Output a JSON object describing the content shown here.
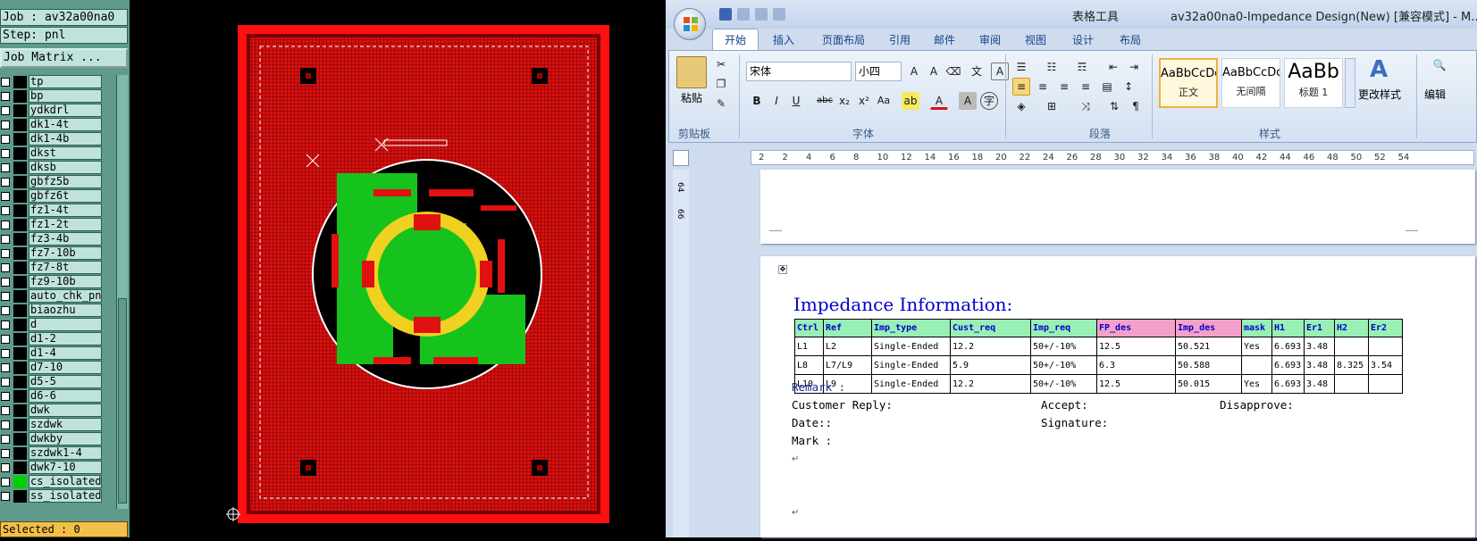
{
  "cam": {
    "job_label": "Job : av32a00na0",
    "step_label": "Step: pnl",
    "job_matrix_button": "Job Matrix ...",
    "selected_status": "Selected : 0",
    "layers": [
      {
        "name": "tp",
        "color": "#000000"
      },
      {
        "name": "bp",
        "color": "#000000"
      },
      {
        "name": "ydkdrl",
        "color": "#000000"
      },
      {
        "name": "dk1-4t",
        "color": "#000000"
      },
      {
        "name": "dk1-4b",
        "color": "#000000"
      },
      {
        "name": "dkst",
        "color": "#000000"
      },
      {
        "name": "dksb",
        "color": "#000000"
      },
      {
        "name": "gbfz5b",
        "color": "#000000"
      },
      {
        "name": "gbfz6t",
        "color": "#000000"
      },
      {
        "name": "fz1-4t",
        "color": "#000000"
      },
      {
        "name": "fz1-2t",
        "color": "#000000"
      },
      {
        "name": "fz3-4b",
        "color": "#000000"
      },
      {
        "name": "fz7-10b",
        "color": "#000000"
      },
      {
        "name": "fz7-8t",
        "color": "#000000"
      },
      {
        "name": "fz9-10b",
        "color": "#000000"
      },
      {
        "name": "auto_chk_pnl",
        "color": "#000000"
      },
      {
        "name": "biaozhu",
        "color": "#000000"
      },
      {
        "name": "d",
        "color": "#000000"
      },
      {
        "name": "d1-2",
        "color": "#000000"
      },
      {
        "name": "d1-4",
        "color": "#000000"
      },
      {
        "name": "d7-10",
        "color": "#000000"
      },
      {
        "name": "d5-5",
        "color": "#000000"
      },
      {
        "name": "d6-6",
        "color": "#000000"
      },
      {
        "name": "dwk",
        "color": "#000000"
      },
      {
        "name": "szdwk",
        "color": "#000000"
      },
      {
        "name": "dwkby",
        "color": "#000000"
      },
      {
        "name": "szdwk1-4",
        "color": "#000000"
      },
      {
        "name": "dwk7-10",
        "color": "#000000"
      },
      {
        "name": "cs_isolated",
        "color": "#00d000"
      },
      {
        "name": "ss_isolated",
        "color": "#000000"
      }
    ]
  },
  "word": {
    "context_tab_title": "表格工具",
    "document_title": "av32a00na0-Impedance Design(New) [兼容模式] - M...",
    "tabs": [
      "开始",
      "插入",
      "页面布局",
      "引用",
      "邮件",
      "审阅",
      "视图",
      "设计",
      "布局"
    ],
    "ribbon": {
      "paste_label": "粘贴",
      "font_name": "宋体",
      "font_size": "小四",
      "clipboard_group": "剪贴板",
      "font_group": "字体",
      "paragraph_group": "段落",
      "styles_group": "样式",
      "change_styles": "更改样式",
      "edit_label": "编辑",
      "styles": [
        {
          "preview": "AaBbCcDd",
          "name": "正文"
        },
        {
          "preview": "AaBbCcDd",
          "name": "无间隔"
        },
        {
          "preview": "AaBb",
          "name": "标题 1"
        }
      ]
    },
    "ruler_numbers": [
      "2",
      "2",
      "4",
      "6",
      "8",
      "10",
      "12",
      "14",
      "16",
      "18",
      "20",
      "22",
      "24",
      "26",
      "28",
      "30",
      "32",
      "34",
      "36",
      "38",
      "40",
      "42",
      "44",
      "46",
      "48",
      "50",
      "52",
      "54"
    ],
    "vruler_labels": [
      "64",
      "66"
    ],
    "document": {
      "heading": "Impedance Information:",
      "table": {
        "headers": [
          "Ctrl",
          "Ref",
          "Imp_type",
          "Cust_req",
          "Imp_req",
          "FP_des",
          "Imp_des",
          "mask",
          "H1",
          "Er1",
          "H2",
          "Er2"
        ],
        "rows": [
          [
            "L1",
            "L2",
            "Single-Ended",
            "12.2",
            "50+/-10%",
            "12.5",
            "50.521",
            "Yes",
            "6.693",
            "3.48",
            "",
            ""
          ],
          [
            "L8",
            "L7/L9",
            "Single-Ended",
            "5.9",
            "50+/-10%",
            "6.3",
            "50.588",
            "",
            "6.693",
            "3.48",
            "8.325",
            "3.54"
          ],
          [
            "L10",
            "L9",
            "Single-Ended",
            "12.2",
            "50+/-10%",
            "12.5",
            "50.015",
            "Yes",
            "6.693",
            "3.48",
            "",
            ""
          ]
        ]
      },
      "remark": "Remark :",
      "customer_reply": "Customer Reply:",
      "accept": "Accept:",
      "disapprove": "Disapprove:",
      "date": "Date::",
      "signature": "Signature:",
      "mark": "Mark :"
    }
  }
}
